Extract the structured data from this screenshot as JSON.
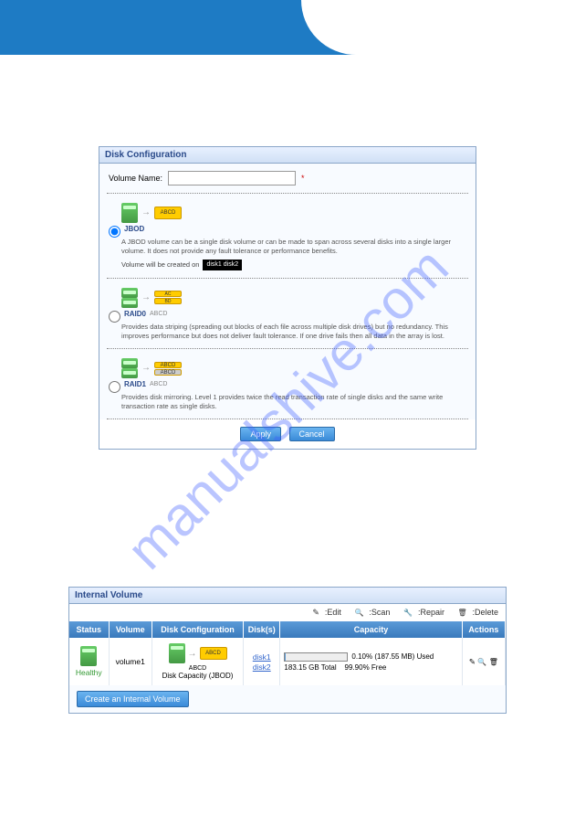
{
  "watermark": "manualshive.com",
  "disk_config": {
    "title": "Disk Configuration",
    "volume_name_label": "Volume Name:",
    "volume_name_value": "",
    "jbod": {
      "label": "JBOD",
      "diag_label": "ABCD",
      "desc": "A JBOD volume can be a single disk volume or can be made to span across several disks into a single larger volume. It does not provide any fault tolerance or performance benefits.",
      "volume_created_label": "Volume will be created on",
      "disk_list": "disk1\ndisk2"
    },
    "raid0": {
      "label": "RAID0",
      "diag_label": "ABCD",
      "desc": "Provides data striping (spreading out blocks of each file across multiple disk drives) but no redundancy. This improves performance but does not deliver fault tolerance. If one drive fails then all data in the array is lost."
    },
    "raid1": {
      "label": "RAID1",
      "diag_label": "ABCD",
      "desc": "Provides disk mirroring. Level 1 provides twice the read transaction rate of single disks and the same write transaction rate as single disks."
    },
    "apply_label": "Apply",
    "cancel_label": "Cancel"
  },
  "internal_volume": {
    "title": "Internal Volume",
    "actions": {
      "edit": ":Edit",
      "scan": ":Scan",
      "repair": ":Repair",
      "delete": ":Delete"
    },
    "columns": [
      "Status",
      "Volume",
      "Disk Configuration",
      "Disk(s)",
      "Capacity",
      "Actions"
    ],
    "row": {
      "status": "Healthy",
      "volume": "volume1",
      "config_diag": "ABCD",
      "config_label": "ABCD",
      "config_caption": "Disk Capacity (JBOD)",
      "disks": [
        "disk1",
        "disk2"
      ],
      "used_pct": "0.10% (187.55 MB) Used",
      "total": "183.15 GB Total",
      "free": "99.90% Free"
    },
    "create_label": "Create an Internal Volume"
  }
}
